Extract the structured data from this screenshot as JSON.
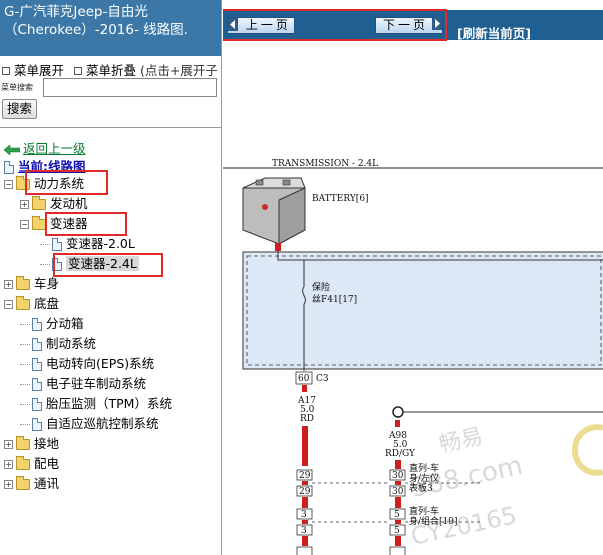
{
  "left_pane": {
    "title_line1": "G-广汽菲克Jeep-自由光",
    "title_line2": "（Cherokee）-2016- 线路图.",
    "expand_all": "菜单展开",
    "collapse_all": "菜单折叠",
    "hint": "(点击+展开子",
    "search_label": "菜单搜索",
    "search_placeholder": "",
    "search_button": "搜索",
    "back_link": "返回上一级",
    "current": "当前:线路图",
    "tree": [
      {
        "label": "动力系统",
        "state": "expanded"
      },
      {
        "label": "发动机",
        "state": "collapsed"
      },
      {
        "label": "变速器",
        "state": "expanded"
      },
      {
        "label": "变速器-2.0L",
        "state": "leaf"
      },
      {
        "label": "变速器-2.4L",
        "state": "leaf-selected"
      },
      {
        "label": "车身",
        "state": "collapsed"
      },
      {
        "label": "底盘",
        "state": "expanded"
      },
      {
        "label": "分动箱",
        "state": "leaf"
      },
      {
        "label": "制动系统",
        "state": "leaf"
      },
      {
        "label": "电动转向(EPS)系统",
        "state": "leaf"
      },
      {
        "label": "电子驻车制动系统",
        "state": "leaf"
      },
      {
        "label": "胎压监测（TPM）系统",
        "state": "leaf"
      },
      {
        "label": "自适应巡航控制系统",
        "state": "leaf"
      },
      {
        "label": "接地",
        "state": "collapsed"
      },
      {
        "label": "配电",
        "state": "collapsed"
      },
      {
        "label": "通讯",
        "state": "collapsed"
      }
    ]
  },
  "navbar": {
    "prev": "上一页",
    "next": "下一页",
    "refresh": "[刷新当前页]"
  },
  "diagram": {
    "title": "TRANSMISSION - 2.4L",
    "battery": "BATTERY[6]",
    "fuse_line1": "保险",
    "fuse_line2": "丝F41[17]",
    "c3_pin": "60",
    "c3": "C3",
    "wire1_line1": "A17",
    "wire1_line2": "5.0",
    "wire1_line3": "RD",
    "wire2_line1": "A98",
    "wire2_line2": "5.0",
    "wire2_line3": "RD/GY",
    "pin_29a": "29",
    "pin_29b": "29",
    "pin_30a": "30",
    "pin_30b": "30",
    "pin_3a": "3",
    "pin_3b": "3",
    "pin_5": "5",
    "pin_3c": "3",
    "pin_5b": "5",
    "ip_line1": "直列-车",
    "ip_line2": "身/左仪",
    "ip_line3": "表板3",
    "bc_line1": "直列-车",
    "bc_line2": "身/组合[19]",
    "watermark1": "畅易",
    "watermark2": "388.com",
    "watermark3": "CY20165"
  },
  "colors": {
    "title_bg": "#3b78a8",
    "navbar_bg": "#1f5f91",
    "highlight_box": "#e02a2a",
    "fuse_panel_bg": "#dce8f5",
    "wire_red": "#cc1f1f"
  }
}
